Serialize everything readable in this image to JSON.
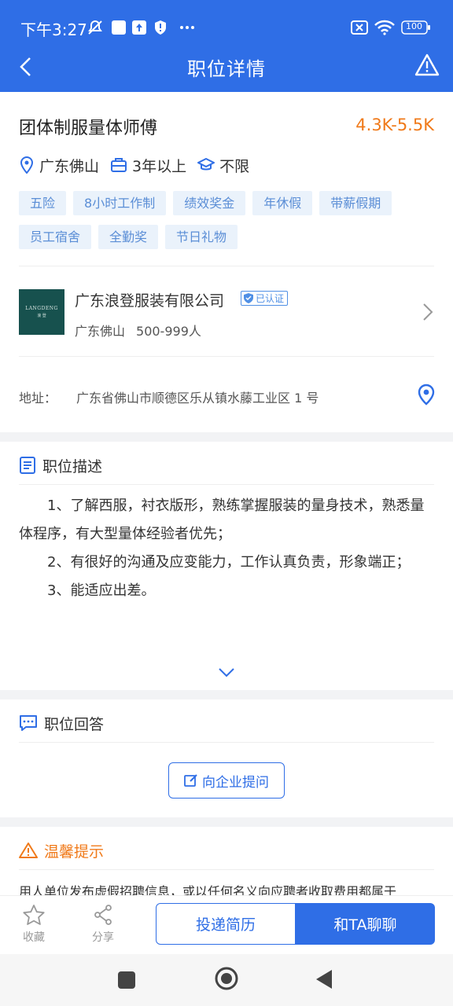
{
  "status_bar": {
    "time": "下午3:27",
    "battery": "100"
  },
  "nav": {
    "title": "职位详情"
  },
  "job": {
    "title": "团体制服量体师傅",
    "salary": "4.3K-5.5K",
    "location": "广东佛山",
    "experience": "3年以上",
    "education": "不限",
    "tags": [
      "五险",
      "8小时工作制",
      "绩效奖金",
      "年休假",
      "带薪假期",
      "员工宿舍",
      "全勤奖",
      "节日礼物"
    ]
  },
  "company": {
    "logo_text_en": "LANGDENG",
    "logo_text_cn": "浪 登",
    "name": "广东浪登服装有限公司",
    "verified": "已认证",
    "city": "广东佛山",
    "size": "500-999人"
  },
  "address": {
    "label": "地址：",
    "value": "广东省佛山市顺德区乐从镇水藤工业区 1 号"
  },
  "description": {
    "title": "职位描述",
    "paragraphs": [
      "1、了解西服，衬衣版形，熟练掌握服装的量身技术，熟悉量体程序，有大型量体经验者优先；",
      "2、有很好的沟通及应变能力，工作认真负责，形象端正；",
      "3、能适应出差。"
    ]
  },
  "qa": {
    "title": "职位回答",
    "ask_button": "向企业提问"
  },
  "notice": {
    "title": "温馨提示",
    "text": "用人单位发布虚假招聘信息，或以任何名义向应聘者收取费用都属于"
  },
  "bottom_bar": {
    "favorite": "收藏",
    "share": "分享",
    "apply": "投递简历",
    "chat": "和TA聊聊"
  },
  "colors": {
    "primary": "#2f6ee6",
    "salary": "#f07a1a",
    "tag_bg": "#eaf2fb",
    "tag_text": "#5b8ed6"
  }
}
